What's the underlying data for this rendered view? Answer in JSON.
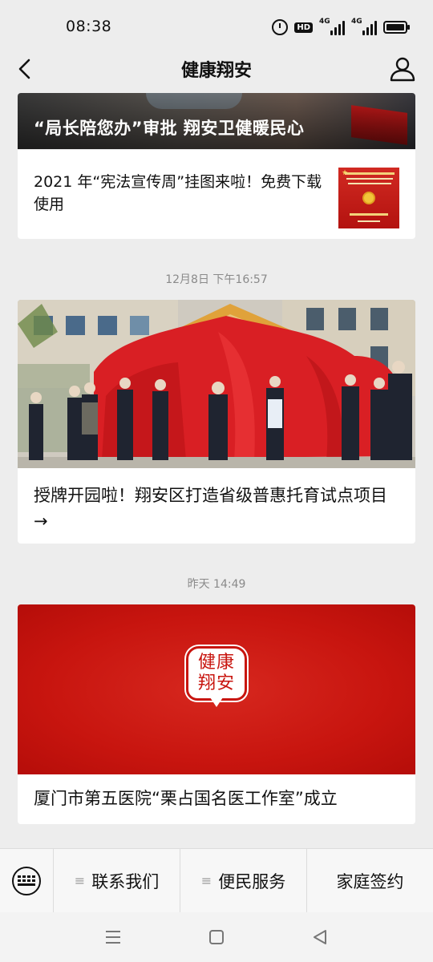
{
  "status_bar": {
    "time": "08:38",
    "icons": [
      "alarm-icon",
      "hd-icon",
      "signal-4g-icon",
      "signal-4g-icon",
      "battery-icon"
    ],
    "hd_label": "HD",
    "net_label_1": "4G",
    "net_label_2": "4G"
  },
  "header": {
    "title": "健康翔安",
    "back_icon": "back-arrow-icon",
    "profile_icon": "user-profile-icon"
  },
  "feed": {
    "card1": {
      "headline": "“局长陪您办”审批 翔安卫健暖民心",
      "sub_article": "2021 年“宪法宣传周”挂图来啦！免费下载使用"
    },
    "timestamp2": "12月8日 下午16:57",
    "card2": {
      "title": "授牌开园啦！翔安区打造省级普惠托育试点项目→"
    },
    "timestamp3": "昨天 14:49",
    "card3": {
      "logo_line1": "健康",
      "logo_line2": "翔安",
      "title": "厦门市第五医院“栗占国名医工作室”成立"
    }
  },
  "bottom_menu": {
    "keyboard_icon": "keyboard-icon",
    "items": [
      {
        "label": "联系我们",
        "icon": "menu-lines-icon"
      },
      {
        "label": "便民服务",
        "icon": "menu-lines-icon"
      },
      {
        "label": "家庭签约"
      }
    ],
    "menu_icon_glyph": "≡"
  },
  "nav_bar": {
    "icons": [
      "recent-apps-icon",
      "home-icon",
      "back-triangle-icon"
    ]
  },
  "colors": {
    "background": "#ededed",
    "brand_red": "#c8150f",
    "timestamp_gray": "#8a8a8a"
  }
}
